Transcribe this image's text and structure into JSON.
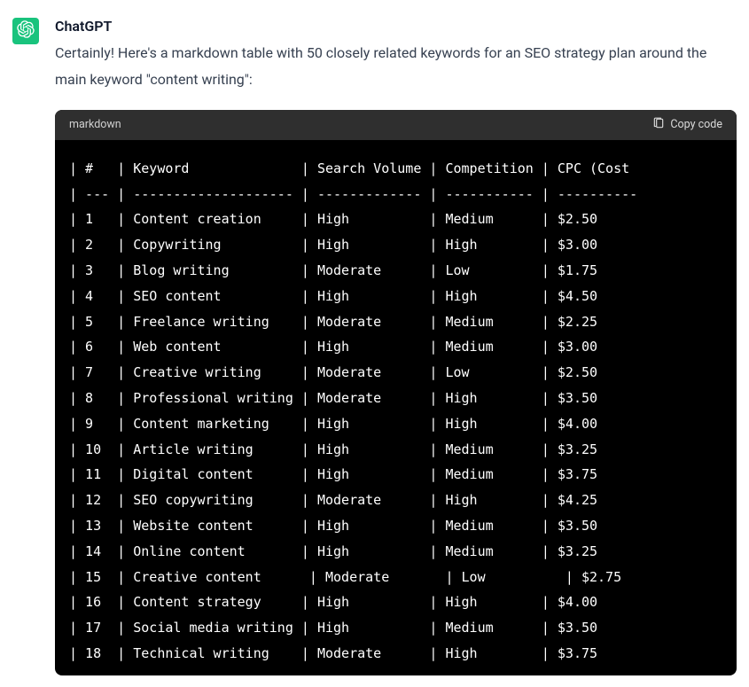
{
  "author": "ChatGPT",
  "body": "Certainly! Here's a markdown table with 50 closely related keywords for an SEO strategy plan around the main keyword \"content writing\":",
  "code": {
    "language": "markdown",
    "copy_label": "Copy code",
    "columns": [
      "#",
      "Keyword",
      "Search Volume",
      "Competition",
      "CPC (Cost"
    ],
    "rows": [
      {
        "n": "1",
        "keyword": "Content creation",
        "volume": "High",
        "competition": "Medium",
        "cpc": "$2.50"
      },
      {
        "n": "2",
        "keyword": "Copywriting",
        "volume": "High",
        "competition": "High",
        "cpc": "$3.00"
      },
      {
        "n": "3",
        "keyword": "Blog writing",
        "volume": "Moderate",
        "competition": "Low",
        "cpc": "$1.75"
      },
      {
        "n": "4",
        "keyword": "SEO content",
        "volume": "High",
        "competition": "High",
        "cpc": "$4.50"
      },
      {
        "n": "5",
        "keyword": "Freelance writing",
        "volume": "Moderate",
        "competition": "Medium",
        "cpc": "$2.25"
      },
      {
        "n": "6",
        "keyword": "Web content",
        "volume": "High",
        "competition": "Medium",
        "cpc": "$3.00"
      },
      {
        "n": "7",
        "keyword": "Creative writing",
        "volume": "Moderate",
        "competition": "Low",
        "cpc": "$2.50"
      },
      {
        "n": "8",
        "keyword": "Professional writing",
        "volume": "Moderate",
        "competition": "High",
        "cpc": "$3.50"
      },
      {
        "n": "9",
        "keyword": "Content marketing",
        "volume": "High",
        "competition": "High",
        "cpc": "$4.00"
      },
      {
        "n": "10",
        "keyword": "Article writing",
        "volume": "High",
        "competition": "Medium",
        "cpc": "$3.25"
      },
      {
        "n": "11",
        "keyword": "Digital content",
        "volume": "High",
        "competition": "Medium",
        "cpc": "$3.75"
      },
      {
        "n": "12",
        "keyword": "SEO copywriting",
        "volume": "Moderate",
        "competition": "High",
        "cpc": "$4.25"
      },
      {
        "n": "13",
        "keyword": "Website content",
        "volume": "High",
        "competition": "Medium",
        "cpc": "$3.50"
      },
      {
        "n": "14",
        "keyword": "Online content",
        "volume": "High",
        "competition": "Medium",
        "cpc": "$3.25"
      },
      {
        "n": "15",
        "keyword": "Creative content",
        "volume": "Moderate",
        "competition": "Low",
        "cpc": "$2.75",
        "shifted": true
      },
      {
        "n": "16",
        "keyword": "Content strategy",
        "volume": "High",
        "competition": "High",
        "cpc": "$4.00"
      },
      {
        "n": "17",
        "keyword": "Social media writing",
        "volume": "High",
        "competition": "Medium",
        "cpc": "$3.50"
      },
      {
        "n": "18",
        "keyword": "Technical writing",
        "volume": "Moderate",
        "competition": "High",
        "cpc": "$3.75"
      }
    ]
  }
}
